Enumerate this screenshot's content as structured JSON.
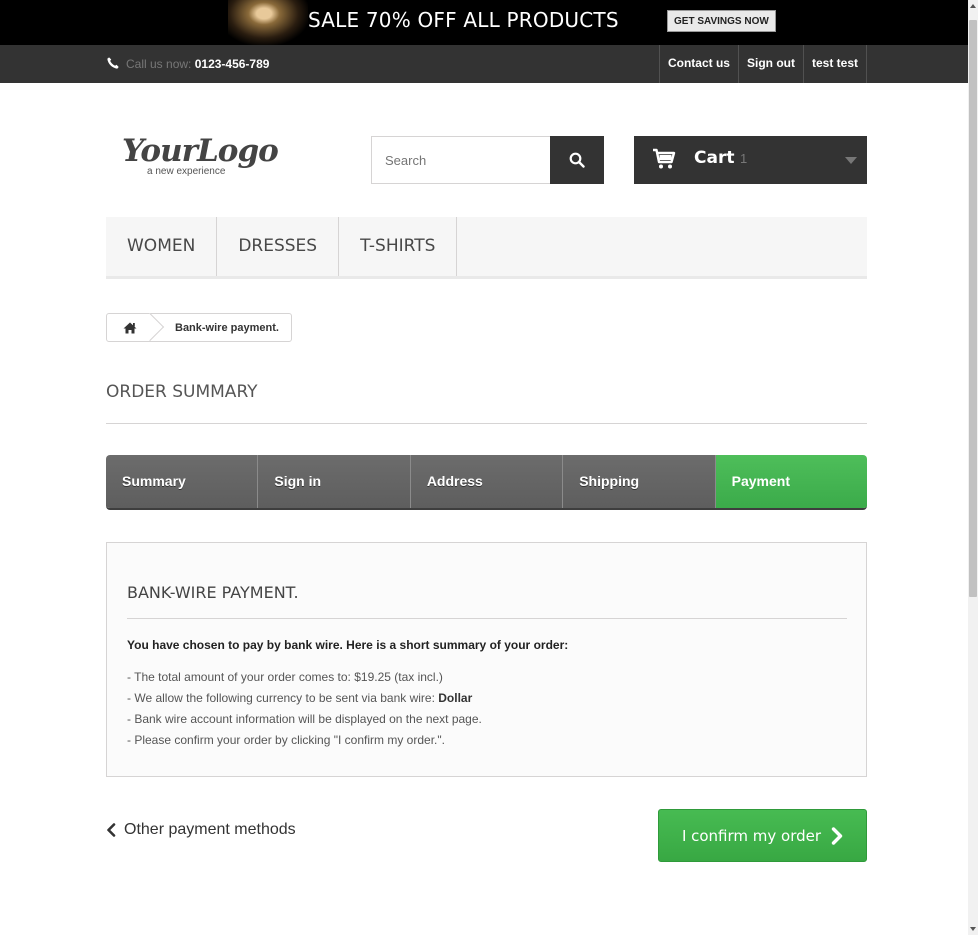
{
  "promo": {
    "text": "SALE 70% OFF ALL PRODUCTS",
    "button": "GET SAVINGS NOW"
  },
  "topbar": {
    "phone_label": "Call us now:",
    "phone_number": "0123-456-789",
    "links": [
      "Contact us",
      "Sign out",
      "test test"
    ]
  },
  "header": {
    "logo_main": "YourLogo",
    "logo_sub": "a new experience",
    "search_placeholder": "Search",
    "cart_label": "Cart",
    "cart_count": "1"
  },
  "menu": {
    "items": [
      "WOMEN",
      "DRESSES",
      "T-SHIRTS"
    ]
  },
  "breadcrumb": {
    "current": "Bank-wire payment."
  },
  "page": {
    "heading": "ORDER SUMMARY"
  },
  "steps": {
    "items": [
      "Summary",
      "Sign in",
      "Address",
      "Shipping",
      "Payment"
    ],
    "active": "Payment"
  },
  "box": {
    "title": "BANK-WIRE PAYMENT.",
    "lead": "You have chosen to pay by bank wire. Here is a short summary of your order:",
    "line1": "- The total amount of your order comes to: $19.25 (tax incl.)",
    "line2_prefix": "- We allow the following currency to be sent via bank wire: ",
    "line2_currency": "Dollar",
    "line3": "- Bank wire account information will be displayed on the next page.",
    "line4": "- Please confirm your order by clicking \"I confirm my order.\"."
  },
  "actions": {
    "back_label": "Other payment methods",
    "confirm_label": "I confirm my order"
  },
  "colors": {
    "dark": "#333333",
    "accent_green": "#3bab4a"
  },
  "icons": [
    "phone-icon",
    "search-icon",
    "cart-icon",
    "caret-down-icon",
    "home-icon",
    "chevron-left-icon",
    "chevron-right-icon"
  ]
}
